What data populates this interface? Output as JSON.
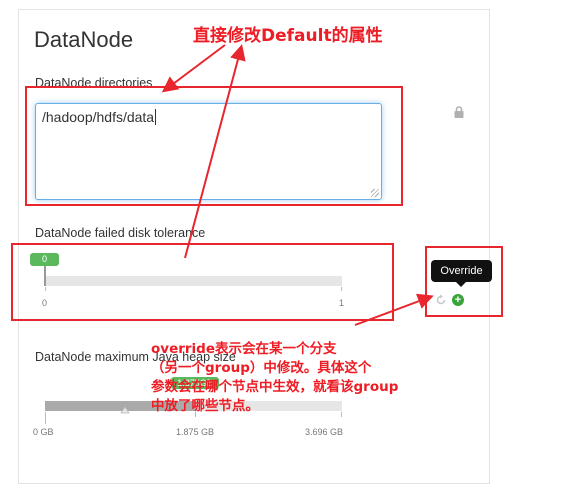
{
  "panel": {
    "title": "DataNode"
  },
  "directories": {
    "label": "DataNode directories",
    "value": "/hadoop/hdfs/data"
  },
  "disk_tolerance": {
    "label": "DataNode failed disk tolerance",
    "current": "0",
    "min_label": "0",
    "max_label": "1",
    "fraction": 0.0
  },
  "override": {
    "tooltip": "Override"
  },
  "heap": {
    "label": "DataNode maximum Java heap size",
    "current": "1.875GB",
    "axis": [
      "0 GB",
      "1.875 GB",
      "3.696 GB"
    ],
    "fraction": 0.507
  },
  "annotations": {
    "top_note": "直接修改Default的属性",
    "override_note_line1": "override表示会在某一个分支",
    "override_note_line2": "（另一个group）中修改。具体这个",
    "override_note_line3": "参数会在哪个节点中生效，就看该group",
    "override_note_line4": "中放了哪些节点。",
    "color": "#ee1c24"
  },
  "icons": {
    "lock": "lock-icon",
    "undo": "undo-icon",
    "add": "plus-circle-icon"
  }
}
